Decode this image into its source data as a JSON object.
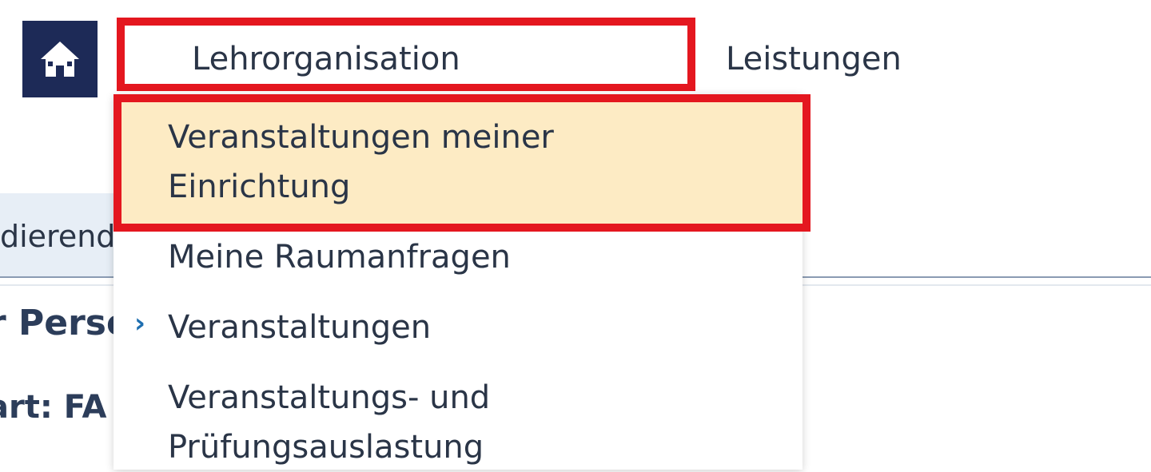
{
  "nav": {
    "home_icon": "home-icon",
    "items": [
      {
        "label": "Lehrorganisation"
      },
      {
        "label": "Leistungen"
      }
    ]
  },
  "background": {
    "subnav_text": "dierenden",
    "heading_partial": "r Perso",
    "subline_partial": "art: FA"
  },
  "dropdown": {
    "items": [
      {
        "line1": "Veranstaltungen meiner",
        "line2": "Einrichtung",
        "state": "highlighted"
      },
      {
        "label": "Meine Raumanfragen"
      },
      {
        "label": "Veranstaltungen",
        "has_submenu": true,
        "submenu_icon": "chevron-right-icon"
      },
      {
        "line1": "Veranstaltungs- und",
        "line2": "Prüfungsauslastung"
      }
    ]
  },
  "colors": {
    "home_bg": "#1d2a57",
    "highlight_border": "#e4171f",
    "active_item_bg": "#fdebc4",
    "text": "#2a3547",
    "chevron": "#1f6fb0"
  }
}
